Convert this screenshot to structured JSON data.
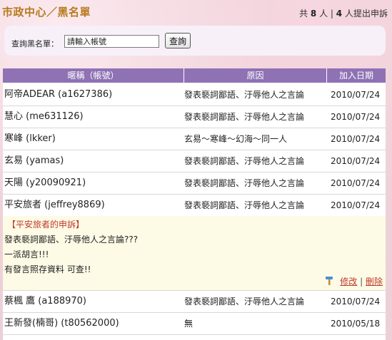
{
  "header": {
    "title": "市政中心／黑名單",
    "stats_prefix": "共",
    "total_count": "8",
    "stats_mid": "人 |",
    "appeal_count": "4",
    "stats_suffix": "人提出申訴"
  },
  "search": {
    "label": "查詢黑名單：",
    "placeholder": "請輸入帳號",
    "button_label": "查詢"
  },
  "table": {
    "columns": [
      "暱稱（帳號）",
      "原因",
      "加入日期"
    ],
    "rows": [
      {
        "name": "阿帝ADEAR (a1627386)",
        "reason": "發表褻詞鄙語、汙辱他人之言論",
        "date": "2010/07/24"
      },
      {
        "name": "慧心 (me631126)",
        "reason": "發表褻詞鄙語、汙辱他人之言論",
        "date": "2010/07/24"
      },
      {
        "name": "寒峰 (lkker)",
        "reason": "玄易～寒峰～幻海～同一人",
        "date": "2010/07/24"
      },
      {
        "name": "玄易 (yamas)",
        "reason": "發表褻詞鄙語、汙辱他人之言論",
        "date": "2010/07/24"
      },
      {
        "name": "天陽 (y20090921)",
        "reason": "發表褻詞鄙語、汙辱他人之言論",
        "date": "2010/07/24"
      },
      {
        "name": "平安旅者 (jeffrey8869)",
        "reason": "發表褻詞鄙語、汙辱他人之言論",
        "date": "2010/07/24"
      },
      {
        "name": "蔡楓 鷹 (a188970)",
        "reason": "發表褻詞鄙語、汙辱他人之言論",
        "date": "2010/07/24"
      },
      {
        "name": "王新發(楠哥) (t80562000)",
        "reason": "無",
        "date": "2010/05/18"
      }
    ],
    "appeal": {
      "title": "【平安旅者的申訴】",
      "lines": [
        "發表褻詞鄙語、汙辱他人之言論???",
        "一派胡言!!!",
        "有發言照存資料 可查!!"
      ],
      "edit_label": "修改",
      "separator": "|",
      "delete_label": "刪除"
    }
  },
  "colors": {
    "header_bg": "#8e72b4",
    "title_color": "#b7791f",
    "appeal_bg": "#fdfbe6",
    "link_color": "#c0392b"
  }
}
